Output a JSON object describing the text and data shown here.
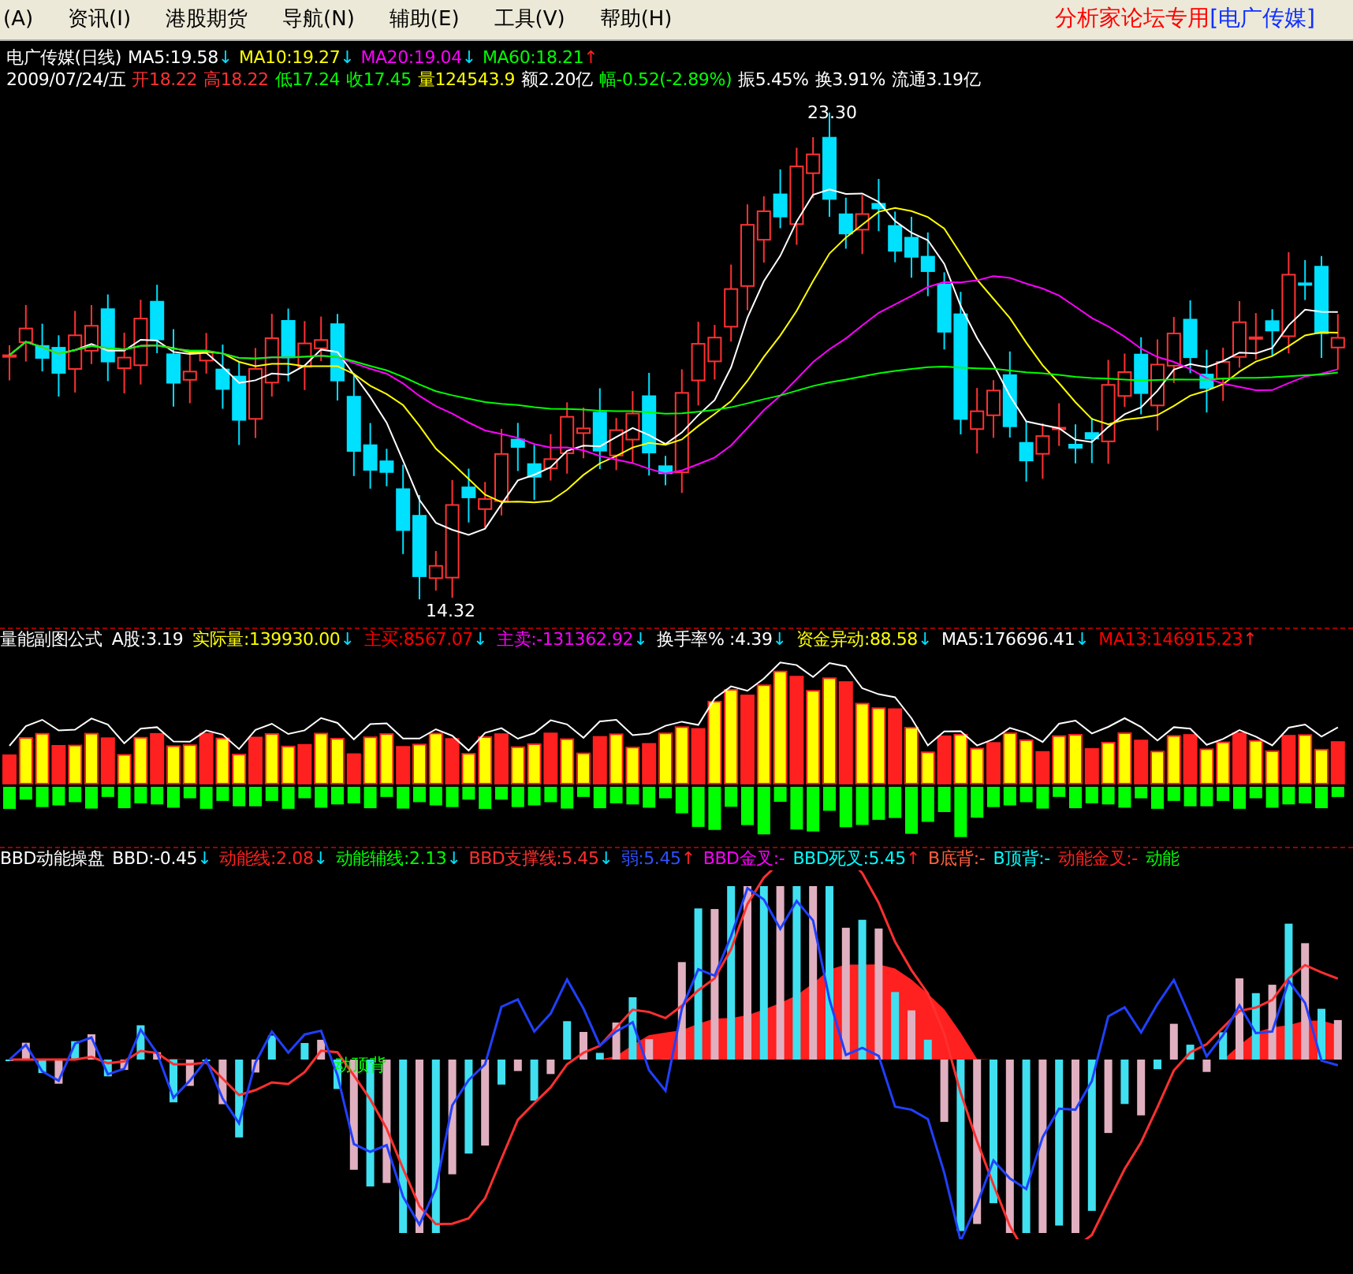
{
  "menu": {
    "items": [
      "(A)",
      "资讯(I)",
      "港股期货",
      "导航(N)",
      "辅助(E)",
      "工具(V)",
      "帮助(H)"
    ],
    "title": "分析家论坛专用",
    "title_stock": "[电广传媒]"
  },
  "main_pane": {
    "legend": [
      {
        "text": "电广传媒(日线)",
        "color": "#ffffff"
      },
      {
        "text": "MA5:19.58",
        "color": "#ffffff",
        "arrow": {
          "text": "↓",
          "color": "#00e0ff"
        }
      },
      {
        "text": "MA10:19.27",
        "color": "#ffff00",
        "arrow": {
          "text": "↓",
          "color": "#00e0ff"
        }
      },
      {
        "text": "MA20:19.04",
        "color": "#ff00ff",
        "arrow": {
          "text": "↓",
          "color": "#00e0ff"
        }
      },
      {
        "text": "MA60:18.21",
        "color": "#00ff00",
        "arrow": {
          "text": "↑",
          "color": "#ff2020"
        }
      }
    ],
    "quote": [
      {
        "text": "2009/07/24/五",
        "color": "#ffffff"
      },
      {
        "text": "开18.22",
        "color": "#ff3232"
      },
      {
        "text": "高18.22",
        "color": "#ff3232"
      },
      {
        "text": "低17.24",
        "color": "#00ff00"
      },
      {
        "text": "收17.45",
        "color": "#00ff00"
      },
      {
        "text": "量124543.9",
        "color": "#ffff00"
      },
      {
        "text": "额2.20亿",
        "color": "#ffffff"
      },
      {
        "text": "幅-0.52(-2.89%)",
        "color": "#00ff00"
      },
      {
        "text": "振5.45%",
        "color": "#ffffff"
      },
      {
        "text": "换3.91%",
        "color": "#ffffff"
      },
      {
        "text": "流通3.19亿",
        "color": "#ffffff"
      }
    ],
    "high_label": "23.30",
    "low_label": "14.32"
  },
  "volume_pane": {
    "legend": [
      {
        "text": "量能副图公式",
        "color": "#ffffff"
      },
      {
        "text": "A股:3.19",
        "color": "#ffffff"
      },
      {
        "text": "实际量:139930.00",
        "color": "#ffff00",
        "arrow": {
          "text": "↓",
          "color": "#00e0ff"
        }
      },
      {
        "text": "主买:8567.07",
        "color": "#ff0000",
        "arrow": {
          "text": "↓",
          "color": "#00e0ff"
        }
      },
      {
        "text": "主卖:-131362.92",
        "color": "#ff00ff",
        "arrow": {
          "text": "↓",
          "color": "#00e0ff"
        }
      },
      {
        "text": "换手率% :4.39",
        "color": "#ffffff",
        "arrow": {
          "text": "↓",
          "color": "#00e0ff"
        }
      },
      {
        "text": "资金异动:88.58",
        "color": "#ffff00",
        "arrow": {
          "text": "↓",
          "color": "#00e0ff"
        }
      },
      {
        "text": "MA5:176696.41",
        "color": "#ffffff",
        "arrow": {
          "text": "↓",
          "color": "#00e0ff"
        }
      },
      {
        "text": "MA13:146915.23",
        "color": "#ff0000",
        "arrow": {
          "text": "↑",
          "color": "#ff2020"
        }
      }
    ]
  },
  "bbd_pane": {
    "legend": [
      {
        "text": "BBD动能操盘",
        "color": "#ffffff"
      },
      {
        "text": "BBD:-0.45",
        "color": "#ffffff",
        "arrow": {
          "text": "↓",
          "color": "#00e0ff"
        }
      },
      {
        "text": "动能线:2.08",
        "color": "#ff2020",
        "arrow": {
          "text": "↓",
          "color": "#00e0ff"
        }
      },
      {
        "text": "动能辅线:2.13",
        "color": "#00ff00",
        "arrow": {
          "text": "↓",
          "color": "#00e0ff"
        }
      },
      {
        "text": "BBD支撑线:5.45",
        "color": "#ff3030",
        "arrow": {
          "text": "↓",
          "color": "#00e0ff"
        }
      },
      {
        "text": "弱:5.45",
        "color": "#3050ff",
        "arrow": {
          "text": "↑",
          "color": "#ff2020"
        }
      },
      {
        "text": "BBD金叉:-",
        "color": "#ff00ff"
      },
      {
        "text": "BBD死叉:5.45",
        "color": "#00ffff",
        "arrow": {
          "text": "↑",
          "color": "#ff2020"
        }
      },
      {
        "text": "B底背:-",
        "color": "#ff6040"
      },
      {
        "text": "B顶背:-",
        "color": "#00ffff"
      },
      {
        "text": "动能金叉:-",
        "color": "#ff2020"
      },
      {
        "text": "动能",
        "color": "#00ff00"
      }
    ],
    "annotation": "动顶背"
  }
}
